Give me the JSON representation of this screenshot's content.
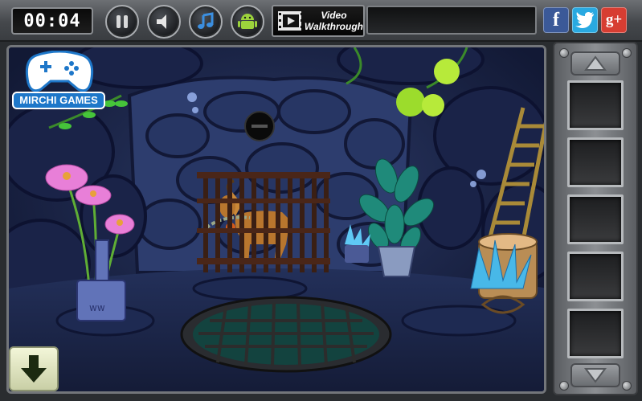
{
  "timer": "00:04",
  "video_button": {
    "line1": "Video",
    "line2": "Walkthrough"
  },
  "social": {
    "facebook": {
      "label": "f",
      "color": "#3b5998"
    },
    "twitter": {
      "label": "t",
      "color": "#29a9e1"
    },
    "google": {
      "label": "g+",
      "color": "#d73d32"
    }
  },
  "logo": {
    "text": "MIRCHI GAMES"
  },
  "inventory": {
    "slot_count": 5
  },
  "colors": {
    "scene_bg": "#1b2446",
    "accent_green": "#9cdc2c"
  }
}
